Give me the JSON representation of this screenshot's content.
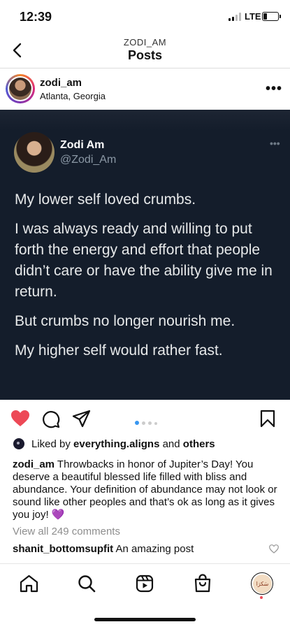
{
  "status_bar": {
    "time": "12:39",
    "network": "LTE",
    "signal_bars": 2,
    "battery_level": 0.2
  },
  "header": {
    "username": "ZODI_AM",
    "title": "Posts",
    "back_icon": "chevron-left-icon"
  },
  "post": {
    "username": "zodi_am",
    "location": "Atlanta, Georgia",
    "more_icon": "more-horizontal-icon",
    "tweet": {
      "name": "Zodi Am",
      "handle": "@Zodi_Am",
      "paragraphs": [
        "My lower self loved crumbs.",
        "I was always ready and willing to put forth the energy and effort that people didn’t care or have the ability give me in return.",
        "But crumbs no longer nourish me.",
        "My higher self would rather fast."
      ]
    },
    "carousel": {
      "total": 4,
      "current": 1
    },
    "actions": {
      "liked": true,
      "like_color": "#ed4956"
    },
    "likes": {
      "prefix": "Liked by",
      "user": "everything.aligns",
      "conj": "and",
      "others": "others"
    },
    "caption": {
      "username": "zodi_am",
      "text": "Throwbacks in honor of Jupiter’s Day! You deserve a beautiful blessed life filled with bliss and abundance. Your definition of abundance may not look or sound like other peoples and that’s ok as long as it gives you joy!",
      "emoji": "💜"
    },
    "view_all_comments": "View all 249 comments",
    "comments": [
      {
        "username": "shanit_bottomsupfit",
        "text": "An amazing post"
      }
    ]
  },
  "nav": {
    "items": [
      "home-icon",
      "search-icon",
      "reels-icon",
      "shop-icon",
      "profile-avatar"
    ],
    "profile_text": "سَكرَا"
  },
  "colors": {
    "tweet_bg": "#141d2b",
    "like_red": "#ed4956",
    "carousel_active": "#3897f0"
  }
}
